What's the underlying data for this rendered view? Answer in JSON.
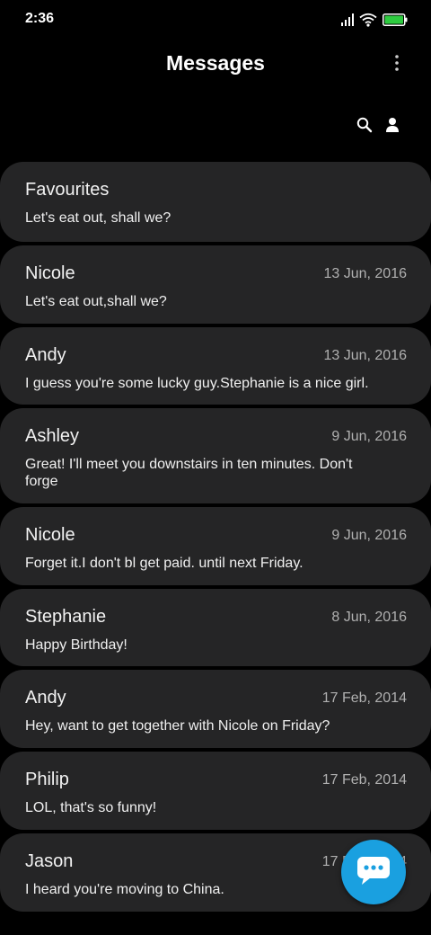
{
  "status_bar": {
    "time": "2:36"
  },
  "header": {
    "title": "Messages"
  },
  "icons": {
    "more": "more-vertical-icon",
    "search": "search-icon",
    "contacts": "person-icon",
    "compose": "chat-bubble-icon"
  },
  "colors": {
    "background": "#000000",
    "card": "#252526",
    "accent": "#1aa0e0",
    "battery": "#2ecc40"
  },
  "conversations": [
    {
      "name": "Favourites",
      "date": "",
      "preview": "Let's eat out, shall we?"
    },
    {
      "name": "Nicole",
      "date": "13 Jun, 2016",
      "preview": "Let's eat out,shall we?"
    },
    {
      "name": "Andy",
      "date": "13 Jun, 2016",
      "preview": "I guess you're some lucky guy.Stephanie is a nice girl."
    },
    {
      "name": "Ashley",
      "date": "9 Jun, 2016",
      "preview": "Great! I'll meet you downstairs in ten minutes. Don't forge"
    },
    {
      "name": "Nicole",
      "date": "9 Jun, 2016",
      "preview": "Forget it.I don't bl get paid. until next Friday."
    },
    {
      "name": "Stephanie",
      "date": "8 Jun, 2016",
      "preview": "Happy Birthday!"
    },
    {
      "name": "Andy",
      "date": "17 Feb, 2014",
      "preview": "Hey, want to get together with Nicole on Friday?"
    },
    {
      "name": "Philip",
      "date": "17 Feb, 2014",
      "preview": "LOL, that's so funny!"
    },
    {
      "name": "Jason",
      "date": "17 Feb, 2014",
      "preview": "I heard you're moving to China."
    }
  ]
}
